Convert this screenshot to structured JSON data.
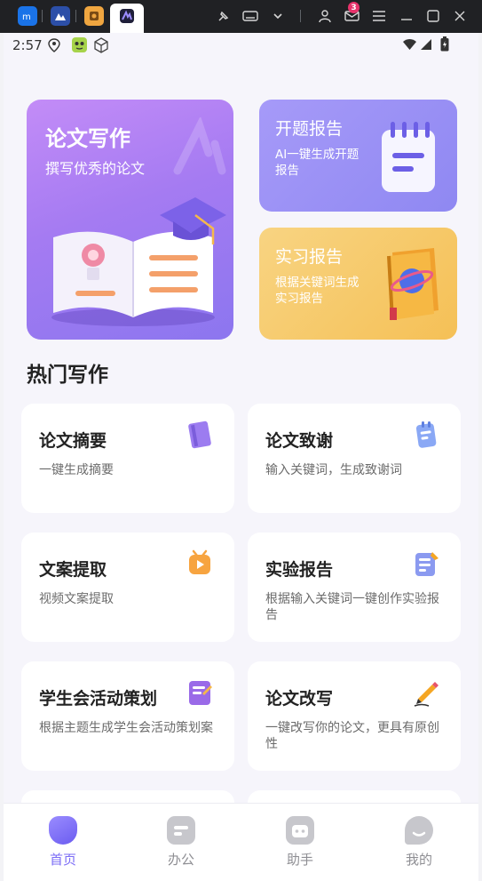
{
  "status": {
    "time": "2:57"
  },
  "window": {
    "notification_count": "3"
  },
  "hero": {
    "main": {
      "title": "论文写作",
      "subtitle": "撰写优秀的论文"
    },
    "proposal": {
      "title": "开题报告",
      "subtitle": "AI一键生成开题报告"
    },
    "internship": {
      "title": "实习报告",
      "subtitle": "根据关键词生成实习报告"
    }
  },
  "section_title": "热门写作",
  "cards": [
    {
      "title": "论文摘要",
      "desc": "一键生成摘要",
      "icon": "book-purple-icon"
    },
    {
      "title": "论文致谢",
      "desc": "输入关键词，生成致谢词",
      "icon": "notepad-blue-icon"
    },
    {
      "title": "文案提取",
      "desc": "视频文案提取",
      "icon": "video-play-icon"
    },
    {
      "title": "实验报告",
      "desc": "根据输入关键词一键创作实验报告",
      "icon": "report-pen-icon"
    },
    {
      "title": "学生会活动策划",
      "desc": "根据主题生成学生会活动策划案",
      "icon": "planner-book-icon"
    },
    {
      "title": "论文改写",
      "desc": "一键改写你的论文，更具有原创性",
      "icon": "pencil-icon"
    }
  ],
  "nav": [
    {
      "label": "首页",
      "active": true
    },
    {
      "label": "办公",
      "active": false
    },
    {
      "label": "助手",
      "active": false
    },
    {
      "label": "我的",
      "active": false
    }
  ],
  "colors": {
    "accent": "#7b6cf6",
    "hero_purple": "#a57bf2",
    "hero_blue": "#8f88f2",
    "hero_yellow": "#f5c056"
  }
}
